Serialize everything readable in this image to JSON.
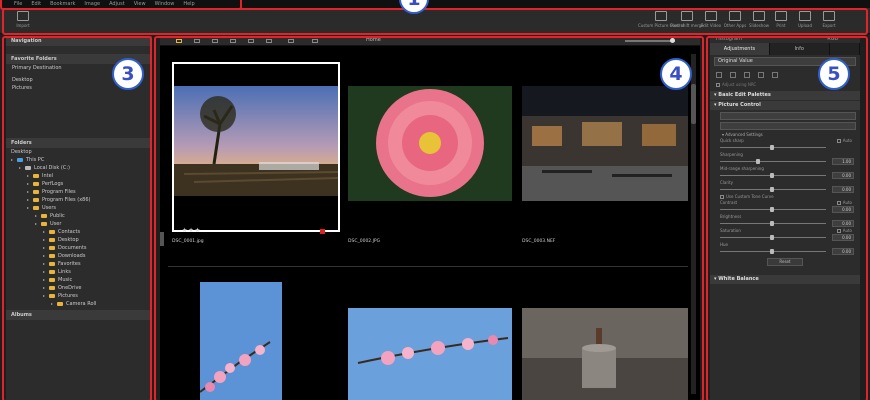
{
  "menubar": {
    "items": [
      "File",
      "Edit",
      "Bookmark",
      "Image",
      "Adjust",
      "View",
      "Window",
      "Help"
    ]
  },
  "toolbar": {
    "import_label": "Import",
    "buttons": [
      {
        "label": "Custom Picture Control"
      },
      {
        "label": "Pixel shift merge"
      },
      {
        "label": "Edit Video"
      },
      {
        "label": "Other Apps"
      },
      {
        "label": "Slideshow"
      },
      {
        "label": "Print"
      },
      {
        "label": "Upload"
      },
      {
        "label": "Export"
      }
    ]
  },
  "badges": {
    "b1": "1",
    "b3": "3",
    "b4": "4",
    "b5": "5"
  },
  "left": {
    "header": "Navigation",
    "favorites_header": "Favorite Folders",
    "primary": "Primary Destination",
    "fav_items": [
      "Desktop",
      "Pictures"
    ],
    "folders_header": "Folders",
    "tree": [
      {
        "label": "Desktop",
        "indent": 0,
        "type": "plain"
      },
      {
        "label": "This PC",
        "indent": 0,
        "type": "pc"
      },
      {
        "label": "Local Disk (C:)",
        "indent": 1,
        "type": "disk"
      },
      {
        "label": "Intel",
        "indent": 2,
        "type": "folder"
      },
      {
        "label": "PerfLogs",
        "indent": 2,
        "type": "folder"
      },
      {
        "label": "Program Files",
        "indent": 2,
        "type": "folder"
      },
      {
        "label": "Program Files (x86)",
        "indent": 2,
        "type": "folder"
      },
      {
        "label": "Users",
        "indent": 2,
        "type": "folder"
      },
      {
        "label": "Public",
        "indent": 3,
        "type": "folder"
      },
      {
        "label": "User",
        "indent": 3,
        "type": "folder"
      },
      {
        "label": "Contacts",
        "indent": 4,
        "type": "folder"
      },
      {
        "label": "Desktop",
        "indent": 4,
        "type": "folder"
      },
      {
        "label": "Documents",
        "indent": 4,
        "type": "folder"
      },
      {
        "label": "Downloads",
        "indent": 4,
        "type": "folder"
      },
      {
        "label": "Favorites",
        "indent": 4,
        "type": "folder"
      },
      {
        "label": "Links",
        "indent": 4,
        "type": "folder"
      },
      {
        "label": "Music",
        "indent": 4,
        "type": "folder"
      },
      {
        "label": "OneDrive",
        "indent": 4,
        "type": "folder"
      },
      {
        "label": "Pictures",
        "indent": 4,
        "type": "folder"
      },
      {
        "label": "Camera Roll",
        "indent": 5,
        "type": "folder"
      }
    ],
    "albums_header": "Albums"
  },
  "center": {
    "home_label": "Home",
    "images": [
      {
        "name": "DSC_0001.jpg",
        "stars": "★★★"
      },
      {
        "name": "DSC_0002.JPG",
        "stars": ""
      },
      {
        "name": "DSC_0003.NEF",
        "stars": ""
      }
    ]
  },
  "right": {
    "top_label": "Histogram",
    "top_right": "RGB",
    "tabs": [
      "Adjustments",
      "Info",
      ""
    ],
    "original_value": "Original Value",
    "adjust_note": "Adjust using NRC",
    "basic_palettes": "Basic Edit Palettes",
    "picture_control": "Picture Control",
    "advanced": "Advanced Settings",
    "quick_sharp": "Quick sharp",
    "auto": "Auto",
    "sharpening": "Sharpening",
    "sharpening_val": "1.00",
    "midrange": "Mid-range sharpening",
    "midrange_val": "0.00",
    "clarity": "Clarity",
    "clarity_val": "0.00",
    "custom_curve": "Use Custom Tone Curve",
    "contrast": "Contrast",
    "contrast_val": "0.00",
    "brightness": "Brightness",
    "brightness_val": "0.00",
    "saturation": "Saturation",
    "saturation_val": "0.00",
    "hue": "Hue",
    "hue_val": "0.00",
    "reset": "Reset",
    "white_balance": "White Balance"
  }
}
